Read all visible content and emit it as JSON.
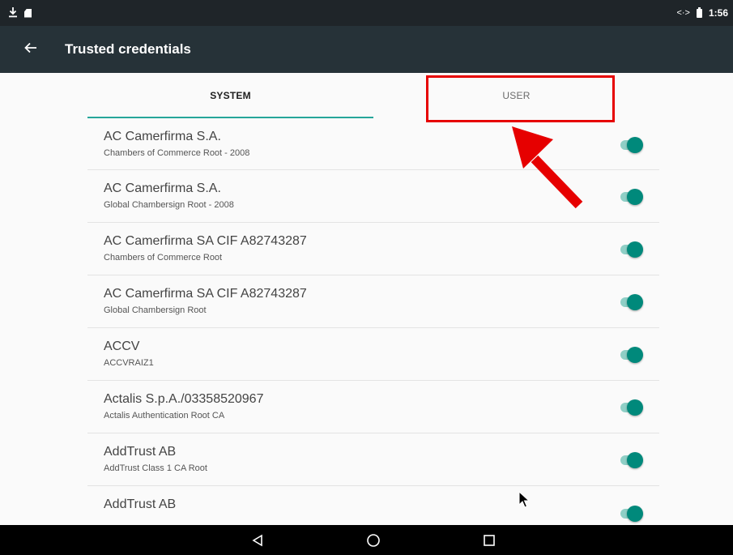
{
  "status_bar": {
    "time": "1:56",
    "icons": [
      "download-icon",
      "sdcard-icon",
      "data-transfer-icon",
      "battery-icon"
    ],
    "data_glyph": "<·>"
  },
  "app_bar": {
    "back_icon": "arrow-back-icon",
    "title": "Trusted credentials"
  },
  "tabs": [
    {
      "label": "SYSTEM",
      "active": true
    },
    {
      "label": "USER",
      "active": false
    }
  ],
  "certificates": [
    {
      "title": "AC Camerfirma S.A.",
      "subtitle": "Chambers of Commerce Root - 2008",
      "enabled": true
    },
    {
      "title": "AC Camerfirma S.A.",
      "subtitle": "Global Chambersign Root - 2008",
      "enabled": true
    },
    {
      "title": "AC Camerfirma SA CIF A82743287",
      "subtitle": "Chambers of Commerce Root",
      "enabled": true
    },
    {
      "title": "AC Camerfirma SA CIF A82743287",
      "subtitle": "Global Chambersign Root",
      "enabled": true
    },
    {
      "title": "ACCV",
      "subtitle": "ACCVRAIZ1",
      "enabled": true
    },
    {
      "title": "Actalis S.p.A./03358520967",
      "subtitle": "Actalis Authentication Root CA",
      "enabled": true
    },
    {
      "title": "AddTrust AB",
      "subtitle": "AddTrust Class 1 CA Root",
      "enabled": true
    },
    {
      "title": "AddTrust AB",
      "subtitle": "",
      "enabled": true
    }
  ],
  "nav_bar": {
    "icons": [
      "back-triangle-icon",
      "home-circle-icon",
      "recents-square-icon"
    ]
  },
  "colors": {
    "accent": "#26a69a",
    "toggle_thumb": "#00897b",
    "app_bar": "#263238",
    "status_bar": "#1f2529",
    "annotation": "#e60000"
  }
}
